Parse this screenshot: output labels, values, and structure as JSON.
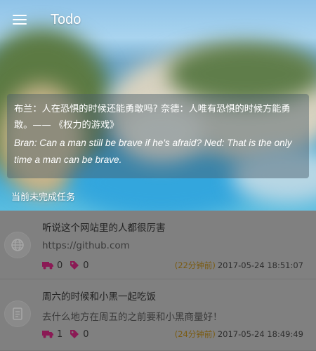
{
  "app": {
    "title": "Todo"
  },
  "quote": {
    "zh": "布兰：人在恐惧的时候还能勇敢吗? 奈德：人唯有恐惧的时候方能勇敢。—— 《权力的游戏》",
    "en": "Bran: Can a man still be brave if he's afraid? Ned: That is the only time a man can be brave."
  },
  "section": {
    "label": "当前未完成任务"
  },
  "colors": {
    "accent": "#8b1a55",
    "list_background": "#808080",
    "time_ago": "#7a5a10"
  },
  "tasks": [
    {
      "title": "听说这个网站里的人都很厉害",
      "description": "https://github.com",
      "icon": "globe-icon",
      "delivery_count": "0",
      "tag_count": "0",
      "time_ago": "(22分钟前)",
      "timestamp": "2017-05-24 18:51:07"
    },
    {
      "title": "周六的时候和小黑一起吃饭",
      "description": "去什么地方在周五的之前要和小黑商量好！",
      "icon": "note-icon",
      "delivery_count": "1",
      "tag_count": "0",
      "time_ago": "(24分钟前)",
      "timestamp": "2017-05-24 18:49:49"
    }
  ]
}
